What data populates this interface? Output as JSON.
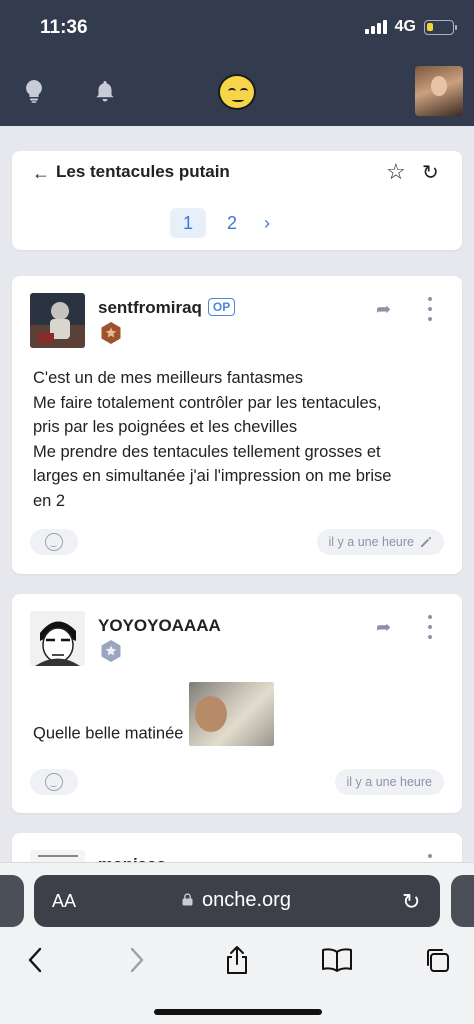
{
  "status_bar": {
    "time": "11:36",
    "network": "4G",
    "battery_color": "#f5d533"
  },
  "app_bar": {
    "left_icons": [
      "lightbulb-icon",
      "bell-icon"
    ],
    "logo": "smiley-logo",
    "background": "#333c4f"
  },
  "topic": {
    "title": "Les tentacules putain",
    "pages": [
      "1",
      "2"
    ],
    "current_page": "1",
    "next_label": "›"
  },
  "posts": [
    {
      "author": "sentfromiraq",
      "op_label": "OP",
      "badge_color": "#a0522d",
      "lines": [
        "C'est un de mes meilleurs fantasmes",
        "Me faire totalement contrôler par les tentacules,",
        "pris par les poignées et les chevilles",
        "Me prendre des tentacules tellement grosses et",
        "larges en simultanée j'ai l'impression on me brise",
        "en 2"
      ],
      "time": "il y a une heure",
      "edited_icon": "pencil-icon"
    },
    {
      "author": "YOYOYOAAAA",
      "badge_color": "#9aa6bf",
      "text": "Quelle belle matinée",
      "time": "il y a une heure"
    },
    {
      "author": "maniaaa"
    }
  ],
  "browser": {
    "text_size_label": "AA",
    "url": "onche.org",
    "toolbar_icons": [
      "back-icon",
      "forward-icon",
      "share-icon",
      "bookmarks-icon",
      "tabs-icon"
    ]
  }
}
